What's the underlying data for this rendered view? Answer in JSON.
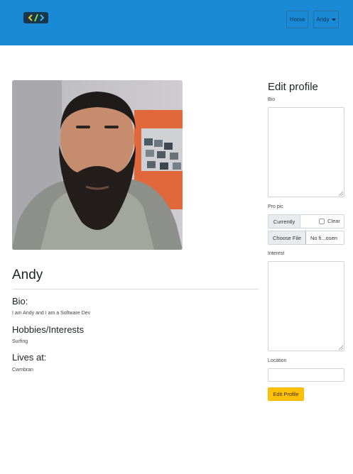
{
  "navbar": {
    "logo_icon": "code-brackets-icon",
    "home_label": "Home",
    "user_menu_label": "Andy",
    "background": "#1a8ad7"
  },
  "profile": {
    "photo": "profile-photo",
    "name": "Andy",
    "bio_heading": "Bio:",
    "bio_text": "I am Andy and I am a Software Dev",
    "interests_heading": "Hobbies/Interests",
    "interests_text": "Surfing",
    "location_heading": "Lives at:",
    "location_text": "Cwmbran"
  },
  "edit_form": {
    "title": "Edit profile",
    "bio_label": "Bio",
    "bio_value": "",
    "pic_label": "Pro pic",
    "currently_label": "Currently",
    "clear_label": "Clear",
    "choose_file_label": "Choose File",
    "file_status": "No fi...osen",
    "interest_label": "Interest",
    "interest_value": "",
    "location_label": "Location",
    "location_value": "",
    "submit_label": "Edit Profile",
    "submit_color": "#ffc107"
  }
}
